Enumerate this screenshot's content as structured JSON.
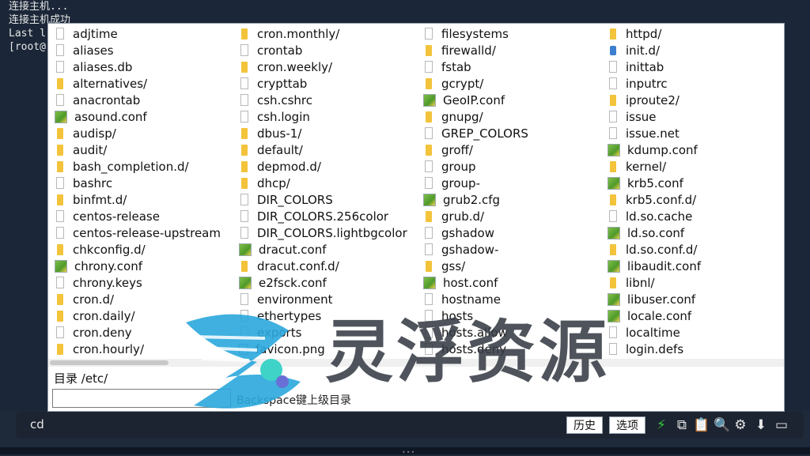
{
  "terminal": {
    "lines": [
      "连接主机...",
      "连接主机成功",
      "Last l",
      "[root@"
    ]
  },
  "files": [
    {
      "name": "adjtime",
      "type": "file"
    },
    {
      "name": "aliases",
      "type": "file"
    },
    {
      "name": "aliases.db",
      "type": "file"
    },
    {
      "name": "alternatives/",
      "type": "folder"
    },
    {
      "name": "anacrontab",
      "type": "file"
    },
    {
      "name": "asound.conf",
      "type": "conf"
    },
    {
      "name": "audisp/",
      "type": "folder"
    },
    {
      "name": "audit/",
      "type": "folder"
    },
    {
      "name": "bash_completion.d/",
      "type": "folder"
    },
    {
      "name": "bashrc",
      "type": "file"
    },
    {
      "name": "binfmt.d/",
      "type": "folder"
    },
    {
      "name": "centos-release",
      "type": "file"
    },
    {
      "name": "centos-release-upstream",
      "type": "file"
    },
    {
      "name": "chkconfig.d/",
      "type": "folder"
    },
    {
      "name": "chrony.conf",
      "type": "conf"
    },
    {
      "name": "chrony.keys",
      "type": "file"
    },
    {
      "name": "cron.d/",
      "type": "folder"
    },
    {
      "name": "cron.daily/",
      "type": "folder"
    },
    {
      "name": "cron.deny",
      "type": "file"
    },
    {
      "name": "cron.hourly/",
      "type": "folder"
    },
    {
      "name": "cron.monthly/",
      "type": "folder"
    },
    {
      "name": "crontab",
      "type": "file"
    },
    {
      "name": "cron.weekly/",
      "type": "folder"
    },
    {
      "name": "crypttab",
      "type": "file"
    },
    {
      "name": "csh.cshrc",
      "type": "file"
    },
    {
      "name": "csh.login",
      "type": "file"
    },
    {
      "name": "dbus-1/",
      "type": "folder"
    },
    {
      "name": "default/",
      "type": "folder"
    },
    {
      "name": "depmod.d/",
      "type": "folder"
    },
    {
      "name": "dhcp/",
      "type": "folder"
    },
    {
      "name": "DIR_COLORS",
      "type": "file"
    },
    {
      "name": "DIR_COLORS.256color",
      "type": "file"
    },
    {
      "name": "DIR_COLORS.lightbgcolor",
      "type": "file"
    },
    {
      "name": "dracut.conf",
      "type": "conf"
    },
    {
      "name": "dracut.conf.d/",
      "type": "folder"
    },
    {
      "name": "e2fsck.conf",
      "type": "conf"
    },
    {
      "name": "environment",
      "type": "file"
    },
    {
      "name": "ethertypes",
      "type": "file"
    },
    {
      "name": "exports",
      "type": "file"
    },
    {
      "name": "favicon.png",
      "type": "image"
    },
    {
      "name": "filesystems",
      "type": "file"
    },
    {
      "name": "firewalld/",
      "type": "folder"
    },
    {
      "name": "fstab",
      "type": "file"
    },
    {
      "name": "gcrypt/",
      "type": "folder"
    },
    {
      "name": "GeoIP.conf",
      "type": "conf"
    },
    {
      "name": "gnupg/",
      "type": "folder"
    },
    {
      "name": "GREP_COLORS",
      "type": "file"
    },
    {
      "name": "groff/",
      "type": "folder"
    },
    {
      "name": "group",
      "type": "file"
    },
    {
      "name": "group-",
      "type": "file"
    },
    {
      "name": "grub2.cfg",
      "type": "conf"
    },
    {
      "name": "grub.d/",
      "type": "folder"
    },
    {
      "name": "gshadow",
      "type": "file"
    },
    {
      "name": "gshadow-",
      "type": "file"
    },
    {
      "name": "gss/",
      "type": "folder"
    },
    {
      "name": "host.conf",
      "type": "conf"
    },
    {
      "name": "hostname",
      "type": "file"
    },
    {
      "name": "hosts",
      "type": "file"
    },
    {
      "name": "hosts.allow",
      "type": "file"
    },
    {
      "name": "hosts.deny",
      "type": "file"
    },
    {
      "name": "httpd/",
      "type": "folder"
    },
    {
      "name": "init.d/",
      "type": "link"
    },
    {
      "name": "inittab",
      "type": "file"
    },
    {
      "name": "inputrc",
      "type": "file"
    },
    {
      "name": "iproute2/",
      "type": "folder"
    },
    {
      "name": "issue",
      "type": "file"
    },
    {
      "name": "issue.net",
      "type": "file"
    },
    {
      "name": "kdump.conf",
      "type": "conf"
    },
    {
      "name": "kernel/",
      "type": "folder"
    },
    {
      "name": "krb5.conf",
      "type": "conf"
    },
    {
      "name": "krb5.conf.d/",
      "type": "folder"
    },
    {
      "name": "ld.so.cache",
      "type": "file"
    },
    {
      "name": "ld.so.conf",
      "type": "conf"
    },
    {
      "name": "ld.so.conf.d/",
      "type": "folder"
    },
    {
      "name": "libaudit.conf",
      "type": "conf"
    },
    {
      "name": "libnl/",
      "type": "folder"
    },
    {
      "name": "libuser.conf",
      "type": "conf"
    },
    {
      "name": "locale.conf",
      "type": "conf"
    },
    {
      "name": "localtime",
      "type": "file"
    },
    {
      "name": "login.defs",
      "type": "file"
    }
  ],
  "popup": {
    "dir_label": "目录 /etc/",
    "input_value": "",
    "hint": "Backspace键上级目录"
  },
  "cmdbar": {
    "command": "cd",
    "history_label": "历史",
    "options_label": "选项"
  },
  "icons": {
    "bolt": "lightning-icon",
    "copy": "copy-icon",
    "paste": "paste-icon",
    "search": "search-icon",
    "settings": "gear-icon",
    "download": "arrow-down-icon",
    "window": "window-icon"
  },
  "watermark": {
    "text": "灵浮资源"
  },
  "colors": {
    "terminal_bg": "#1b2738",
    "folder": "#f3c33b",
    "bolt": "#34c93c"
  }
}
